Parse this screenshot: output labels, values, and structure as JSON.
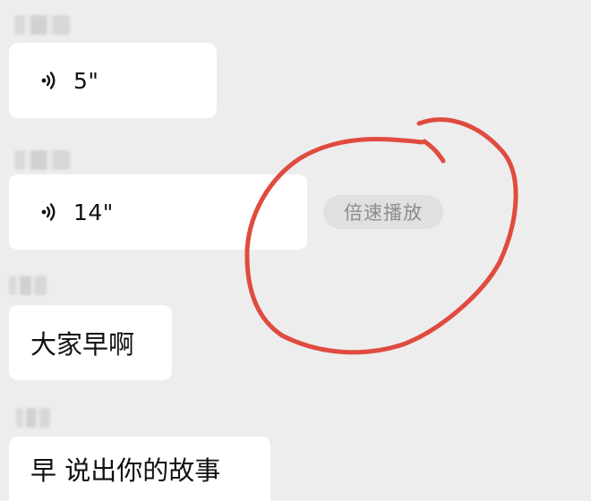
{
  "messages": [
    {
      "type": "voice",
      "duration": "5\"",
      "icon": "voice-wave-icon"
    },
    {
      "type": "voice",
      "duration": "14\"",
      "icon": "voice-wave-icon"
    },
    {
      "type": "text",
      "text": "大家早啊"
    },
    {
      "type": "text",
      "text": "早 说出你的故事"
    }
  ],
  "speed_button": {
    "label": "倍速播放"
  },
  "colors": {
    "background": "#ededed",
    "bubble": "#ffffff",
    "chip": "#e0e0e0",
    "chip_text": "#8d8d8d",
    "annotation": "#e04b3f"
  }
}
